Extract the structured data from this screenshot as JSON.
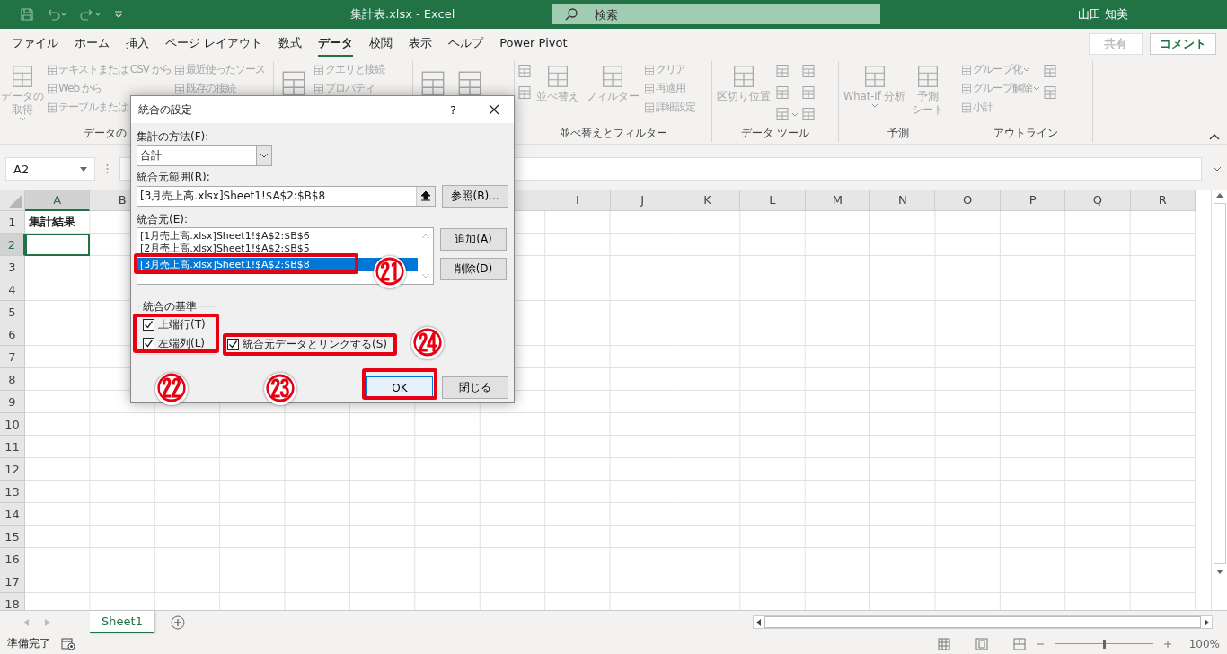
{
  "title_bar": {
    "title": "集計表.xlsx  -  Excel",
    "search": {
      "placeholder": "検索"
    },
    "user": "山田 知美"
  },
  "menu_tabs": [
    {
      "label": "ファイル",
      "selected": false
    },
    {
      "label": "ホーム",
      "selected": false
    },
    {
      "label": "挿入",
      "selected": false
    },
    {
      "label": "ページ レイアウト",
      "selected": false
    },
    {
      "label": "数式",
      "selected": false
    },
    {
      "label": "データ",
      "selected": true
    },
    {
      "label": "校閲",
      "selected": false
    },
    {
      "label": "表示",
      "selected": false
    },
    {
      "label": "ヘルプ",
      "selected": false
    },
    {
      "label": "Power Pivot",
      "selected": false
    }
  ],
  "share_button": "共有",
  "comment_button": "コメント",
  "ribbon": {
    "groups": [
      {
        "label": "データの",
        "columns": [
          [
            {
              "kind": "large",
              "lines": [
                "データの",
                "取得"
              ],
              "dropdown": true
            }
          ],
          [
            {
              "kind": "small",
              "label": "テキストまたは CSV から"
            },
            {
              "kind": "small",
              "label": "Web から"
            },
            {
              "kind": "small",
              "label": "テーブルまたは"
            }
          ],
          [
            {
              "kind": "small",
              "label": "最近使ったソース"
            },
            {
              "kind": "small",
              "label": "既存の接続"
            }
          ]
        ]
      },
      {
        "columns": [
          [
            {
              "kind": "large"
            }
          ],
          [
            {
              "kind": "small",
              "label": "クエリと接続"
            },
            {
              "kind": "small",
              "label": "プロパティ"
            }
          ]
        ]
      },
      {
        "columns": [
          [
            {
              "kind": "large"
            }
          ],
          [
            {
              "kind": "large"
            }
          ]
        ]
      },
      {
        "label": "並べ替えとフィルター",
        "columns": [
          [
            {
              "kind": "small"
            },
            {
              "kind": "small"
            }
          ],
          [
            {
              "kind": "large",
              "lines": [
                "並べ替え"
              ]
            }
          ],
          [
            {
              "kind": "large",
              "lines": [
                "フィルター"
              ]
            }
          ],
          [
            {
              "kind": "small",
              "label": "クリア"
            },
            {
              "kind": "small",
              "label": "再適用"
            },
            {
              "kind": "small",
              "label": "詳細設定"
            }
          ]
        ]
      },
      {
        "label": "データ ツール",
        "columns": [
          [
            {
              "kind": "large",
              "lines": [
                "区切り位置"
              ]
            }
          ],
          [
            {
              "kind": "small"
            },
            {
              "kind": "small"
            },
            {
              "kind": "small",
              "dropdown": true
            }
          ],
          [
            {
              "kind": "small"
            },
            {
              "kind": "small"
            },
            {
              "kind": "small"
            }
          ]
        ]
      },
      {
        "label": "予測",
        "columns": [
          [
            {
              "kind": "large",
              "lines": [
                "What-If 分析"
              ],
              "dropdown": true
            }
          ],
          [
            {
              "kind": "large",
              "lines": [
                "予測",
                "シート"
              ]
            }
          ]
        ]
      },
      {
        "label": "アウトライン",
        "columns": [
          [
            {
              "kind": "small",
              "label": "グループ化",
              "dropdown": true
            },
            {
              "kind": "small",
              "label": "グループ解除",
              "dropdown": true
            },
            {
              "kind": "small",
              "label": "小計"
            }
          ],
          [
            {
              "kind": "small"
            },
            {
              "kind": "small"
            }
          ]
        ]
      }
    ]
  },
  "formula_bar": {
    "name_box": "A2"
  },
  "sheet": {
    "columns": [
      {
        "label": "A",
        "selected": true
      },
      {
        "label": "B",
        "selected": false
      },
      {
        "label": "I",
        "selected": false
      },
      {
        "label": "J",
        "selected": false
      },
      {
        "label": "K",
        "selected": false
      },
      {
        "label": "L",
        "selected": false
      },
      {
        "label": "M",
        "selected": false
      },
      {
        "label": "N",
        "selected": false
      },
      {
        "label": "O",
        "selected": false
      },
      {
        "label": "P",
        "selected": false
      },
      {
        "label": "Q",
        "selected": false
      },
      {
        "label": "R",
        "selected": false
      }
    ],
    "rows": [
      {
        "number": "1",
        "selected": false,
        "cells": [
          {
            "text": "集計結果",
            "selected": false
          }
        ]
      },
      {
        "number": "2",
        "selected": true,
        "cells": [
          {
            "selected": true
          }
        ]
      },
      {
        "number": "3",
        "selected": false
      },
      {
        "number": "4",
        "selected": false
      },
      {
        "number": "5",
        "selected": false
      },
      {
        "number": "6",
        "selected": false
      },
      {
        "number": "7",
        "selected": false
      },
      {
        "number": "8",
        "selected": false
      },
      {
        "number": "9",
        "selected": false
      },
      {
        "number": "10",
        "selected": false
      },
      {
        "number": "11",
        "selected": false
      },
      {
        "number": "12",
        "selected": false
      },
      {
        "number": "13",
        "selected": false
      },
      {
        "number": "14",
        "selected": false
      },
      {
        "number": "15",
        "selected": false
      },
      {
        "number": "16",
        "selected": false
      },
      {
        "number": "17",
        "selected": false
      },
      {
        "number": "18",
        "selected": false
      }
    ]
  },
  "sheet_tabs": [
    {
      "label": "Sheet1",
      "selected": true
    }
  ],
  "status_bar": {
    "status": "準備完了",
    "zoom": {
      "level": 0.5,
      "reading": "100%"
    }
  },
  "dialog": {
    "title": "統合の設定",
    "help": "?",
    "function_label": "集計の方法(F):",
    "function_value": "合計",
    "reference_label": "統合元範囲(R):",
    "reference_value": "[3月売上高.xlsx]Sheet1!$A$2:$B$8",
    "browse_button": "参照(B)...",
    "references_label": "統合元(E):",
    "references": [
      {
        "text": "[1月売上高.xlsx]Sheet1!$A$2:$B$6",
        "selected": false
      },
      {
        "text": "[2月売上高.xlsx]Sheet1!$A$2:$B$5",
        "selected": false
      },
      {
        "text": "[3月売上高.xlsx]Sheet1!$A$2:$B$8",
        "selected": true
      }
    ],
    "add_button": "追加(A)",
    "delete_button": "削除(D)",
    "labels_group": "統合の基準",
    "checkboxes": [
      {
        "label": "上端行(T)",
        "checked": true
      },
      {
        "label": "左端列(L)",
        "checked": true
      },
      {
        "label": "統合元データとリンクする(S)",
        "checked": true
      }
    ],
    "ok_button": "OK",
    "close_button": "閉じる",
    "step_badges": [
      "㉑",
      "㉒",
      "㉓",
      "㉔"
    ]
  }
}
